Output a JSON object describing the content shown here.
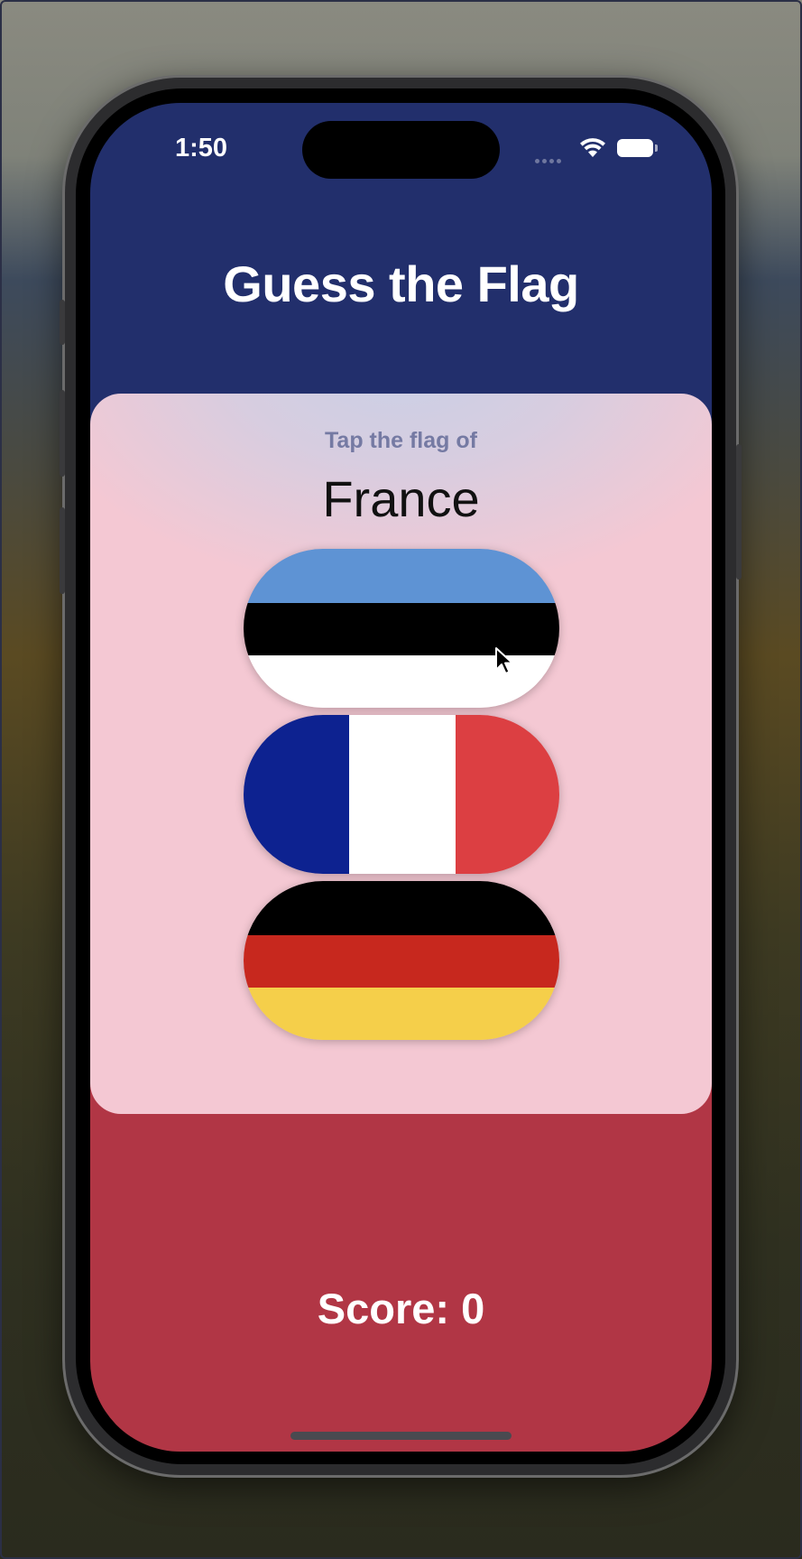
{
  "status_bar": {
    "time": "1:50"
  },
  "header": {
    "title": "Guess the Flag"
  },
  "question": {
    "prompt": "Tap the flag of",
    "country": "France"
  },
  "flags": [
    {
      "name": "Estonia",
      "orientation": "horizontal",
      "colors": [
        "#5e93d4",
        "#000000",
        "#ffffff"
      ]
    },
    {
      "name": "France",
      "orientation": "vertical",
      "colors": [
        "#0d2290",
        "#ffffff",
        "#dc3f42"
      ]
    },
    {
      "name": "Germany",
      "orientation": "horizontal",
      "colors": [
        "#000000",
        "#c7281e",
        "#f5cf4a"
      ]
    }
  ],
  "footer": {
    "score_label": "Score: 0"
  },
  "colors": {
    "top_background": "#222f6c",
    "bottom_background": "#b13645",
    "card_background": "#f4c8d3",
    "prompt_text": "#757aa3"
  },
  "icons": {
    "signal": "cellular-signal-icon",
    "wifi": "wifi-icon",
    "battery": "battery-icon",
    "cursor": "mouse-cursor-icon"
  }
}
